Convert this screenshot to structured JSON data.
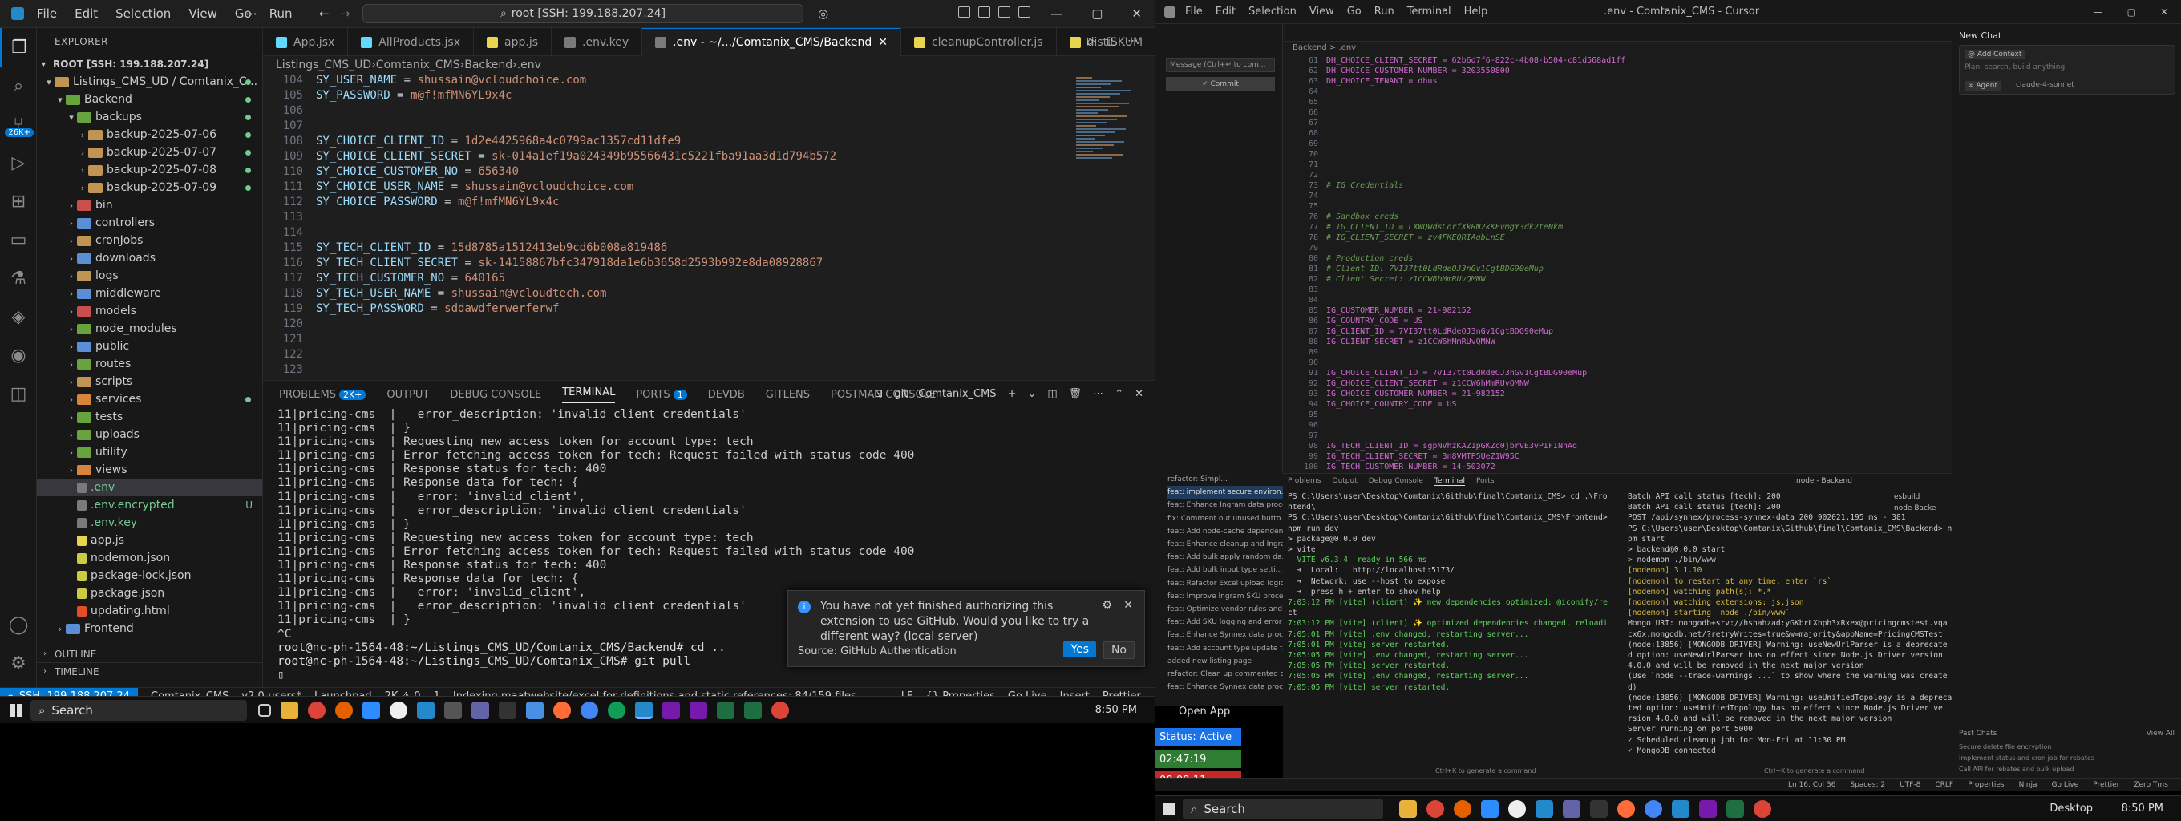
{
  "left": {
    "menu": [
      "File",
      "Edit",
      "Selection",
      "View",
      "Go",
      "Run"
    ],
    "command_center": "root [SSH: 199.188.207.24]",
    "explorer_title": "EXPLORER",
    "root_label": "ROOT [SSH: 199.188.207.24]",
    "tree": [
      {
        "label": "Listings_CMS_UD / Comtanix_C...",
        "depth": 0,
        "type": "folder-open"
      },
      {
        "label": "Backend",
        "depth": 1,
        "type": "folder-open"
      },
      {
        "label": "backups",
        "depth": 2,
        "type": "folder-open"
      },
      {
        "label": "backup-2025-07-06",
        "depth": 3,
        "type": "folder"
      },
      {
        "label": "backup-2025-07-07",
        "depth": 3,
        "type": "folder"
      },
      {
        "label": "backup-2025-07-08",
        "depth": 3,
        "type": "folder"
      },
      {
        "label": "backup-2025-07-09",
        "depth": 3,
        "type": "folder"
      },
      {
        "label": "bin",
        "depth": 2,
        "type": "folder"
      },
      {
        "label": "controllers",
        "depth": 2,
        "type": "folder"
      },
      {
        "label": "cronJobs",
        "depth": 2,
        "type": "folder"
      },
      {
        "label": "downloads",
        "depth": 2,
        "type": "folder"
      },
      {
        "label": "logs",
        "depth": 2,
        "type": "folder"
      },
      {
        "label": "middleware",
        "depth": 2,
        "type": "folder"
      },
      {
        "label": "models",
        "depth": 2,
        "type": "folder"
      },
      {
        "label": "node_modules",
        "depth": 2,
        "type": "folder"
      },
      {
        "label": "public",
        "depth": 2,
        "type": "folder"
      },
      {
        "label": "routes",
        "depth": 2,
        "type": "folder"
      },
      {
        "label": "scripts",
        "depth": 2,
        "type": "folder"
      },
      {
        "label": "services",
        "depth": 2,
        "type": "folder"
      },
      {
        "label": "tests",
        "depth": 2,
        "type": "folder"
      },
      {
        "label": "uploads",
        "depth": 2,
        "type": "folder"
      },
      {
        "label": "utility",
        "depth": 2,
        "type": "folder"
      },
      {
        "label": "views",
        "depth": 2,
        "type": "folder"
      },
      {
        "label": ".env",
        "depth": 2,
        "type": "file"
      },
      {
        "label": ".env.encrypted",
        "depth": 2,
        "type": "file"
      },
      {
        "label": ".env.key",
        "depth": 2,
        "type": "file"
      },
      {
        "label": "app.js",
        "depth": 2,
        "type": "file"
      },
      {
        "label": "nodemon.json",
        "depth": 2,
        "type": "file"
      },
      {
        "label": "package-lock.json",
        "depth": 2,
        "type": "file"
      },
      {
        "label": "package.json",
        "depth": 2,
        "type": "file"
      },
      {
        "label": "updating.html",
        "depth": 2,
        "type": "file"
      },
      {
        "label": "Frontend",
        "depth": 1,
        "type": "folder"
      }
    ],
    "untracked_mark": "U",
    "outline_label": "OUTLINE",
    "timeline_label": "TIMELINE",
    "tabs": [
      "App.jsx",
      "AllProducts.jsx",
      "app.js",
      ".env.key",
      ".env - ~/.../Comtanix_CMS/Backend",
      "cleanupController.js",
      "distiSKUM"
    ],
    "breadcrumb": [
      "Listings_CMS_UD",
      "Comtanix_CMS",
      "Backend",
      ".env"
    ],
    "code": [
      {
        "n": "104",
        "k": "SY_USER_NAME",
        "v": "shussain@vcloudchoice.com"
      },
      {
        "n": "105",
        "k": "SY_PASSWORD",
        "v": "m@f!mfMN6YL9x4c"
      },
      {
        "n": "106",
        "k": "",
        "v": ""
      },
      {
        "n": "107",
        "k": "",
        "v": ""
      },
      {
        "n": "108",
        "k": "SY_CHOICE_CLIENT_ID",
        "v": "1d2e4425968a4c0799ac1357cd11dfe9"
      },
      {
        "n": "109",
        "k": "SY_CHOICE_CLIENT_SECRET",
        "v": "sk-014a1ef19a024349b95566431c5221fba91aa3d1d794b572"
      },
      {
        "n": "110",
        "k": "SY_CHOICE_CUSTOMER_NO",
        "v": "656340"
      },
      {
        "n": "111",
        "k": "SY_CHOICE_USER_NAME",
        "v": "shussain@vcloudchoice.com"
      },
      {
        "n": "112",
        "k": "SY_CHOICE_PASSWORD",
        "v": "m@f!mfMN6YL9x4c"
      },
      {
        "n": "113",
        "k": "",
        "v": ""
      },
      {
        "n": "114",
        "k": "",
        "v": ""
      },
      {
        "n": "115",
        "k": "SY_TECH_CLIENT_ID",
        "v": "15d8785a1512413eb9cd6b008a819486"
      },
      {
        "n": "116",
        "k": "SY_TECH_CLIENT_SECRET",
        "v": "sk-14158867bfc347918da1e6b3658d2593b992e8da08928867"
      },
      {
        "n": "117",
        "k": "SY_TECH_CUSTOMER_NO",
        "v": "640165"
      },
      {
        "n": "118",
        "k": "SY_TECH_USER_NAME",
        "v": "shussain@vcloudtech.com"
      },
      {
        "n": "119",
        "k": "SY_TECH_PASSWORD",
        "v": "sddawdferwerferwf"
      },
      {
        "n": "120",
        "k": "",
        "v": ""
      },
      {
        "n": "121",
        "k": "",
        "v": ""
      },
      {
        "n": "122",
        "k": "",
        "v": ""
      },
      {
        "n": "123",
        "k": "",
        "v": ""
      }
    ],
    "panel_tabs": [
      "PROBLEMS",
      "OUTPUT",
      "DEBUG CONSOLE",
      "TERMINAL",
      "PORTS",
      "DEVDB",
      "GITLENS",
      "POSTMAN CONSOLE"
    ],
    "problems_badge": "2K+",
    "ports_badge": "1",
    "terminal_name": "git - Comtanix_CMS",
    "terminal_lines": [
      "11|pricing-cms  |   error_description: 'invalid client credentials'",
      "11|pricing-cms  | }",
      "11|pricing-cms  | Requesting new access token for account type: tech",
      "11|pricing-cms  | Error fetching access token for tech: Request failed with status code 400",
      "11|pricing-cms  | Response status for tech: 400",
      "11|pricing-cms  | Response data for tech: {",
      "11|pricing-cms  |   error: 'invalid_client',",
      "11|pricing-cms  |   error_description: 'invalid client credentials'",
      "11|pricing-cms  | }",
      "11|pricing-cms  | Requesting new access token for account type: tech",
      "11|pricing-cms  | Error fetching access token for tech: Request failed with status code 400",
      "11|pricing-cms  | Response status for tech: 400",
      "11|pricing-cms  | Response data for tech: {",
      "11|pricing-cms  |   error: 'invalid_client',",
      "11|pricing-cms  |   error_description: 'invalid client credentials'",
      "11|pricing-cms  | }",
      "^C",
      "root@nc-ph-1564-48:~/Listings_CMS_UD/Comtanix_CMS/Backend# cd ..",
      "root@nc-ph-1564-48:~/Listings_CMS_UD/Comtanix_CMS# git pull"
    ],
    "toast": {
      "message": "You have not yet finished authorizing this extension to use GitHub. Would you like to try a different way? (local server)",
      "source": "Source: GitHub Authentication",
      "yes": "Yes",
      "no": "No"
    },
    "status": {
      "remote": "SSH: 199.188.207.24",
      "items": [
        "Comtanix_CMS",
        "v2.0-users*",
        "Launchpad",
        "2K ⚠ 0",
        "1",
        "Indexing maatwebsite/excel for definitions and static references: 84/159 files",
        "LF",
        "{} Properties",
        "Go Live",
        "Insert",
        "Prettier"
      ]
    },
    "taskbar": {
      "search": "Search",
      "time": "8:50 PM"
    }
  },
  "right": {
    "menu": [
      "File",
      "Edit",
      "Selection",
      "View",
      "Go",
      "Run",
      "Terminal",
      "Help"
    ],
    "title": ".env - Comtanix_CMS - Cursor",
    "scm_input": "Message (Ctrl+↵ to com...",
    "scm_commit": "✓ Commit",
    "breadcrumb": "Backend > .env",
    "code": [
      {
        "n": "61",
        "t": "DH_CHOICE_CLIENT_SECRET = 62b6d7f6-822c-4b08-b504-c81d568ad1ff",
        "c": "k"
      },
      {
        "n": "62",
        "t": "DH_CHOICE_CUSTOMER_NUMBER = 3203550800",
        "c": "k"
      },
      {
        "n": "63",
        "t": "DH_CHOICE_TENANT = dhus",
        "c": "k"
      },
      {
        "n": "64",
        "t": "",
        "c": "k"
      },
      {
        "n": "65",
        "t": "",
        "c": "k"
      },
      {
        "n": "66",
        "t": "",
        "c": "k"
      },
      {
        "n": "67",
        "t": "",
        "c": "k"
      },
      {
        "n": "68",
        "t": "",
        "c": "k"
      },
      {
        "n": "69",
        "t": "",
        "c": "k"
      },
      {
        "n": "70",
        "t": "",
        "c": "k"
      },
      {
        "n": "71",
        "t": "",
        "c": "k"
      },
      {
        "n": "72",
        "t": "",
        "c": "k"
      },
      {
        "n": "73",
        "t": "# IG Credentials",
        "c": "cm"
      },
      {
        "n": "74",
        "t": "",
        "c": "k"
      },
      {
        "n": "75",
        "t": "",
        "c": "k"
      },
      {
        "n": "76",
        "t": "# Sandbox creds",
        "c": "cm"
      },
      {
        "n": "77",
        "t": "# IG_CLIENT_ID = LXWQWdsCorfXkRN2kKEvmgY3dk2teNkm",
        "c": "cm"
      },
      {
        "n": "78",
        "t": "# IG_CLIENT_SECRET = zv4FKEQRIAqbLnSE",
        "c": "cm"
      },
      {
        "n": "79",
        "t": "",
        "c": "k"
      },
      {
        "n": "80",
        "t": "# Production creds",
        "c": "cm"
      },
      {
        "n": "81",
        "t": "# Client ID: 7VI37tt0LdRdeOJ3nGv1CgtBDG90eMup",
        "c": "cm"
      },
      {
        "n": "82",
        "t": "# Client Secret: z1CCW6hMmRUvQMNW",
        "c": "cm"
      },
      {
        "n": "83",
        "t": "",
        "c": "k"
      },
      {
        "n": "84",
        "t": "",
        "c": "k"
      },
      {
        "n": "85",
        "t": "IG_CUSTOMER_NUMBER = 21-982152",
        "c": "k"
      },
      {
        "n": "86",
        "t": "IG_COUNTRY_CODE = US",
        "c": "k"
      },
      {
        "n": "87",
        "t": "IG_CLIENT_ID = 7VI37tt0LdRdeOJ3nGv1CgtBDG90eMup",
        "c": "k"
      },
      {
        "n": "88",
        "t": "IG_CLIENT_SECRET = z1CCW6hMmRUvQMNW",
        "c": "k"
      },
      {
        "n": "89",
        "t": "",
        "c": "k"
      },
      {
        "n": "90",
        "t": "",
        "c": "k"
      },
      {
        "n": "91",
        "t": "IG_CHOICE_CLIENT_ID = 7VI37tt0LdRdeOJ3nGv1CgtBDG90eMup",
        "c": "k"
      },
      {
        "n": "92",
        "t": "IG_CHOICE_CLIENT_SECRET = z1CCW6hMmRUvQMNW",
        "c": "k"
      },
      {
        "n": "93",
        "t": "IG_CHOICE_CUSTOMER_NUMBER = 21-982152",
        "c": "k"
      },
      {
        "n": "94",
        "t": "IG_CHOICE_COUNTRY_CODE = US",
        "c": "k"
      },
      {
        "n": "95",
        "t": "",
        "c": "k"
      },
      {
        "n": "96",
        "t": "",
        "c": "k"
      },
      {
        "n": "97",
        "t": "",
        "c": "k"
      },
      {
        "n": "98",
        "t": "IG_TECH_CLIENT_ID = sgpNVhzKAZ1pGKZc0jbrVE3vPIFINnAd",
        "c": "k"
      },
      {
        "n": "99",
        "t": "IG_TECH_CLIENT_SECRET = 3n8VMTP5UeZ1W95C",
        "c": "k"
      },
      {
        "n": "100",
        "t": "IG_TECH_CUSTOMER_NUMBER = 14-503072",
        "c": "k"
      },
      {
        "n": "101",
        "t": "IG_TECH_COUNTRY_CODE = US",
        "c": "k"
      }
    ],
    "scm_commits": [
      "refactor: Simpl...",
      "feat: implement secure environ...",
      "feat: Enhance Ingram data proce...",
      "fix: Comment out unused butto...",
      "feat: Add node-cache dependen...",
      "feat: Enhance cleanup and Ingra...",
      "feat: Add bulk apply random da...",
      "feat: Add bulk input type setti...",
      "feat: Refactor Excel upload logic...",
      "feat: Improve Ingram SKU proce...",
      "feat: Optimize vendor rules and...",
      "feat: Add SKU logging and error ...",
      "feat: Enhance Synnex data proce...",
      "feat: Add account type update f...",
      "added new listing page",
      "refactor: Clean up commented c...",
      "feat: Enhance Synnex data proce..."
    ],
    "panel_tabs": [
      "Problems",
      "Output",
      "Debug Console",
      "Terminal",
      "Ports"
    ],
    "term1": [
      "PS C:\\Users\\user\\Desktop\\Comtanix\\Github\\final\\Comtanix_CMS> cd .\\Fro",
      "ntend\\",
      "PS C:\\Users\\user\\Desktop\\Comtanix\\Github\\final\\Comtanix_CMS\\Frontend>",
      "npm run dev",
      "",
      "> package@0.0.0 dev",
      "> vite",
      "",
      "",
      "  VITE v6.3.4  ready in 566 ms",
      "",
      "  ➜  Local:   http://localhost:5173/",
      "  ➜  Network: use --host to expose",
      "  ➜  press h + enter to show help",
      "7:03:12 PM [vite] (client) ✨ new dependencies optimized: @iconify/re",
      "ct",
      "7:03:12 PM [vite] (client) ✨ optimized dependencies changed. reloadi",
      "7:05:01 PM [vite] .env changed, restarting server...",
      "7:05:01 PM [vite] server restarted.",
      "7:05:05 PM [vite] .env changed, restarting server...",
      "7:05:05 PM [vite] server restarted.",
      "7:05:05 PM [vite] .env changed, restarting server...",
      "7:05:05 PM [vite] server restarted."
    ],
    "term2": [
      "Batch API call status [tech]: 200",
      "Batch API call status [tech]: 200",
      "POST /api/synnex/process-synnex-data 200 902021.195 ms - 381",
      "PS C:\\Users\\user\\Desktop\\Comtanix\\Github\\final\\Comtanix_CMS\\Backend> n",
      "pm start",
      "",
      "> backend@0.0.0 start",
      "> nodemon ./bin/www",
      "",
      "[nodemon] 3.1.10",
      "[nodemon] to restart at any time, enter `rs`",
      "[nodemon] watching path(s): *.*",
      "[nodemon] watching extensions: js,json",
      "[nodemon] starting `node ./bin/www`",
      "Mongo URI: mongodb+srv://hshahzad:yGKbrLXhph3xRxex@pricingcmstest.vqa",
      "cx6x.mongodb.net/?retryWrites=true&w=majority&appName=PricingCMSTest",
      "(node:13856) [MONGODB DRIVER] Warning: useNewUrlParser is a deprecate",
      "d option: useNewUrlParser has no effect since Node.js Driver version",
      "4.0.0 and will be removed in the next major version",
      "(Use `node --trace-warnings ...` to show where the warning was create",
      "d)",
      "(node:13856) [MONGODB DRIVER] Warning: useUnifiedTopology is a depreca",
      "ted option: useUnifiedTopology has no effect since Node.js Driver ve",
      "rsion 4.0.0 and will be removed in the next major version",
      "Server running on port 5000",
      "✓ Scheduled cleanup job for Mon-Fri at 11:30 PM",
      "✓ MongoDB connected"
    ],
    "term_tabs": [
      "esbuild",
      "node Backe"
    ],
    "term_label": "node - Backend",
    "chat": {
      "title": "New Chat",
      "add_context": "@ Add Context",
      "placeholder": "Plan, search, build anything",
      "agent": "∞ Agent",
      "model": "claude-4-sonnet",
      "past": "Past Chats",
      "view_all": "View All",
      "items": [
        "Secure delete file encryption",
        "Implement status and cron job for rebates",
        "Call API for rebates and bulk upload"
      ]
    },
    "overlay": {
      "open_app": "Open App",
      "status": "Status: Active",
      "timer1": "02:47:19",
      "timer2": "00:09:11"
    },
    "status_items": [
      "Ln 16, Col 36",
      "Spaces: 2",
      "UTF-8",
      "CRLF",
      "Properties",
      "Ninja",
      "Go Live",
      "Prettier",
      "Zero Tms"
    ],
    "taskbar": {
      "search": "Search",
      "desktop": "Desktop",
      "time": "8:50 PM"
    }
  },
  "colors": {
    "accent": "#0078d4",
    "key": "#9cdcfe",
    "value": "#ce9178",
    "pink": "#d16ad1",
    "git": "#73c991"
  }
}
